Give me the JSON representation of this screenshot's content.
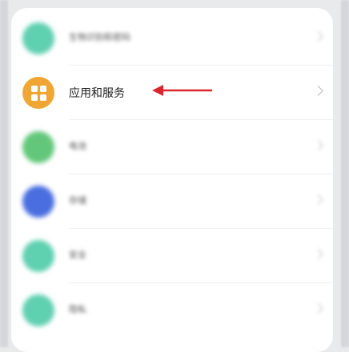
{
  "list": {
    "items": [
      {
        "label": "生物识别和密码",
        "icon": "lock-icon",
        "icon_color": "#5fd0b0",
        "blurred": true
      },
      {
        "label": "应用和服务",
        "icon": "apps-icon",
        "icon_color": "#f0a634",
        "blurred": false
      },
      {
        "label": "电池",
        "icon": "battery-icon",
        "icon_color": "#63c77b",
        "blurred": true
      },
      {
        "label": "存储",
        "icon": "storage-icon",
        "icon_color": "#4a6ee0",
        "blurred": true
      },
      {
        "label": "安全",
        "icon": "shield-icon",
        "icon_color": "#5fd0b0",
        "blurred": true
      },
      {
        "label": "隐私",
        "icon": "privacy-icon",
        "icon_color": "#5fd0b0",
        "blurred": true
      }
    ]
  },
  "annotation": {
    "arrow_color": "#d9262c"
  }
}
